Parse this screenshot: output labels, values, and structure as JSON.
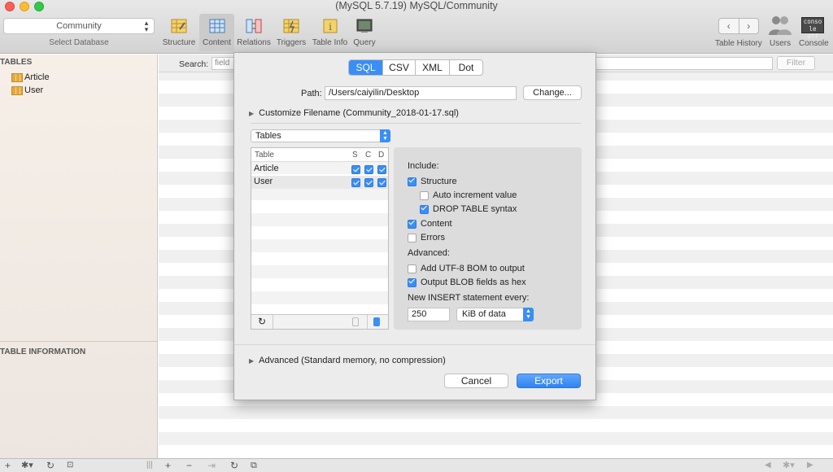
{
  "window": {
    "title": "(MySQL 5.7.19) MySQL/Community"
  },
  "toolbar": {
    "database_value": "Community",
    "database_caption": "Select Database",
    "buttons": [
      {
        "label": "Structure",
        "icon": "structure-icon"
      },
      {
        "label": "Content",
        "icon": "content-icon",
        "active": true
      },
      {
        "label": "Relations",
        "icon": "relations-icon"
      },
      {
        "label": "Triggers",
        "icon": "triggers-icon"
      },
      {
        "label": "Table Info",
        "icon": "table-info-icon"
      },
      {
        "label": "Query",
        "icon": "query-icon"
      }
    ],
    "nav_back": "‹",
    "nav_forward": "›",
    "table_history_label": "Table History",
    "users_label": "Users",
    "console_label": "Console",
    "console_icon_text_1": "conso",
    "console_icon_text_2": "le off"
  },
  "sidebar": {
    "tables_header": "TABLES",
    "items": [
      {
        "label": "Article"
      },
      {
        "label": "User"
      }
    ],
    "info_header": "TABLE INFORMATION"
  },
  "search": {
    "label": "Search:",
    "placeholder": "field",
    "filter_label": "Filter"
  },
  "export_sheet": {
    "formats": [
      {
        "label": "SQL",
        "selected": true
      },
      {
        "label": "CSV"
      },
      {
        "label": "XML"
      },
      {
        "label": "Dot"
      }
    ],
    "path_label": "Path:",
    "path_value": "/Users/caiyilin/Desktop",
    "change_label": "Change...",
    "customize_filename": "Customize Filename (Community_2018-01-17.sql)",
    "tables_select": "Tables",
    "table_columns": {
      "name": "Table",
      "s": "S",
      "c": "C",
      "d": "D"
    },
    "table_rows": [
      {
        "name": "Article",
        "s": true,
        "c": true,
        "d": true
      },
      {
        "name": "User",
        "s": true,
        "c": true,
        "d": true
      }
    ],
    "include_label": "Include:",
    "options": {
      "structure": {
        "label": "Structure",
        "checked": true
      },
      "auto_increment": {
        "label": "Auto increment value",
        "checked": false
      },
      "drop_table": {
        "label": "DROP TABLE syntax",
        "checked": true
      },
      "content": {
        "label": "Content",
        "checked": true
      },
      "errors": {
        "label": "Errors",
        "checked": false
      }
    },
    "advanced_label": "Advanced:",
    "advanced_options": {
      "utf8_bom": {
        "label": "Add UTF-8 BOM to output",
        "checked": false
      },
      "blob_hex": {
        "label": "Output BLOB fields as hex",
        "checked": true
      }
    },
    "insert_every_label": "New INSERT statement every:",
    "insert_every_value": "250",
    "insert_unit": "KiB of data",
    "advanced_disclosure": "Advanced (Standard memory, no compression)",
    "cancel_label": "Cancel",
    "export_label": "Export"
  },
  "colors": {
    "accent": "#3a8ef6",
    "close": "#fc5f57",
    "minimize": "#fdbc2e",
    "maximize": "#34c84a"
  }
}
